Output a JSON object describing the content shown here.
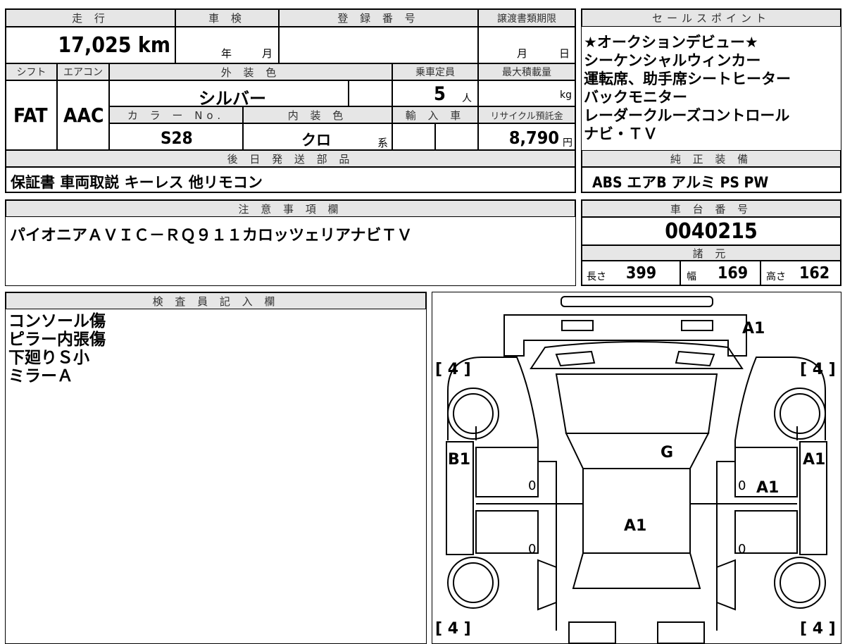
{
  "top": {
    "h_mileage": "走 行",
    "h_inspection": "車 検",
    "h_registration": "登 録 番 号",
    "h_transfer": "譲渡書類期限",
    "mileage": "17,025 km",
    "insp_year": "年",
    "insp_month": "月",
    "transfer_month": "月",
    "transfer_day": "日",
    "h_shift": "シフト",
    "h_ac": "エアコン",
    "h_exterior": "外 装 色",
    "h_capacity": "乗車定員",
    "h_maxload": "最大積載量",
    "shift": "FAT",
    "ac": "AAC",
    "exterior": "シルバー",
    "capacity": "5",
    "capacity_unit": "人",
    "maxload_unit": "kg",
    "h_colorno": "カ ラ ー No.",
    "h_interior": "内 装 色",
    "h_import": "輸 入 車",
    "h_recycle": "リサイクル預託金",
    "colorno": "S28",
    "interior": "クロ",
    "interior_suffix": "系",
    "recycle": "8,790",
    "recycle_unit": "円",
    "h_later_parts": "後 日 発 送 部 品",
    "later_parts": "保証書 車両取説 キーレス 他リモコン"
  },
  "sales": {
    "header": "セールスポイント",
    "lines": [
      "★オークションデビュー★",
      "シーケンシャルウィンカー",
      "運転席、助手席シートヒーター",
      "バックモニター",
      "レーダークルーズコントロール",
      "ナビ・ＴＶ"
    ],
    "h_equipment": "純 正 装 備",
    "equipment": "ABS エアB アルミ PS PW"
  },
  "notes": {
    "header": "注 意 事 項 欄",
    "text": "パイオニアＡＶＩＣ－ＲＱ９１１カロッツェリアナビＴＶ"
  },
  "chassis": {
    "header": "車 台 番 号",
    "number": "0040215",
    "h_specs": "諸 元",
    "len_label": "長さ",
    "len": "399",
    "wid_label": "幅",
    "wid": "169",
    "hgt_label": "高さ",
    "hgt": "162"
  },
  "inspector": {
    "header": "検 査 員 記 入 欄",
    "lines": [
      "コンソール傷",
      "ピラー内張傷",
      "下廻りＳ小",
      "ミラーＡ"
    ]
  },
  "diagram": {
    "tire_tl": "[ 4 ]",
    "tire_tr": "[ 4 ]",
    "tire_bl": "[ 4 ]",
    "tire_br": "[ 4 ]",
    "mark_front": "A1",
    "mark_left_fender": "B1",
    "mark_right_fender": "A1",
    "mark_glass": "G",
    "mark_right_door": "A1",
    "mark_roof": "A1",
    "zero_1": "0",
    "zero_2": "0",
    "zero_3": "0",
    "zero_4": "0"
  }
}
